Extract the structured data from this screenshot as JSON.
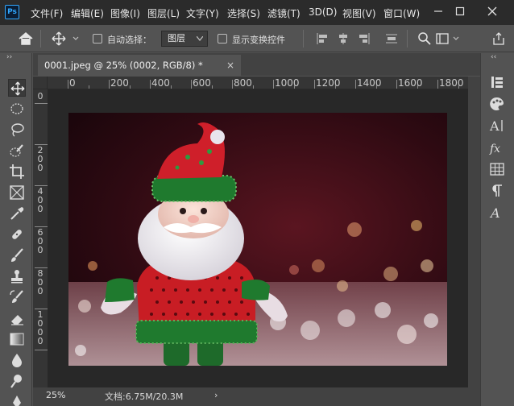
{
  "app": {
    "logo": "Ps"
  },
  "menu": [
    "文件(F)",
    "编辑(E)",
    "图像(I)",
    "图层(L)",
    "文字(Y)",
    "选择(S)",
    "滤镜(T)",
    "3D(D)",
    "视图(V)",
    "窗口(W)"
  ],
  "options": {
    "auto_select_label": "自动选择：",
    "auto_select_target": "图层",
    "show_transform_label": "显示变换控件"
  },
  "document": {
    "tab_title": "0001.jpeg @ 25% (0002, RGB/8) *",
    "tab_close": "×"
  },
  "ruler": {
    "h_ticks": [
      "0",
      "200",
      "400",
      "600",
      "800",
      "1000",
      "1200",
      "1400",
      "1600",
      "1800"
    ],
    "v_ticks": [
      "0",
      "2\n0\n0",
      "4\n0\n0",
      "6\n0\n0",
      "8\n0\n0",
      "1\n0\n0\n0"
    ]
  },
  "status": {
    "zoom": "25%",
    "doc_info": "文档:6.75M/20.3M",
    "arrow": "›"
  },
  "icons": {
    "tools": [
      "move-tool-icon",
      "marquee-tool-icon",
      "lasso-tool-icon",
      "quick-select-tool-icon",
      "crop-tool-icon",
      "frame-tool-icon",
      "eyedropper-tool-icon",
      "healing-brush-tool-icon",
      "brush-tool-icon",
      "clone-stamp-tool-icon",
      "history-brush-tool-icon",
      "eraser-tool-icon",
      "gradient-tool-icon",
      "blur-tool-icon",
      "dodge-tool-icon"
    ],
    "panels": [
      "history-panel-icon",
      "color-panel-icon",
      "character-panel-icon",
      "styles-panel-icon",
      "table-panel-icon",
      "paragraph-panel-icon",
      "glyphs-panel-icon"
    ]
  }
}
